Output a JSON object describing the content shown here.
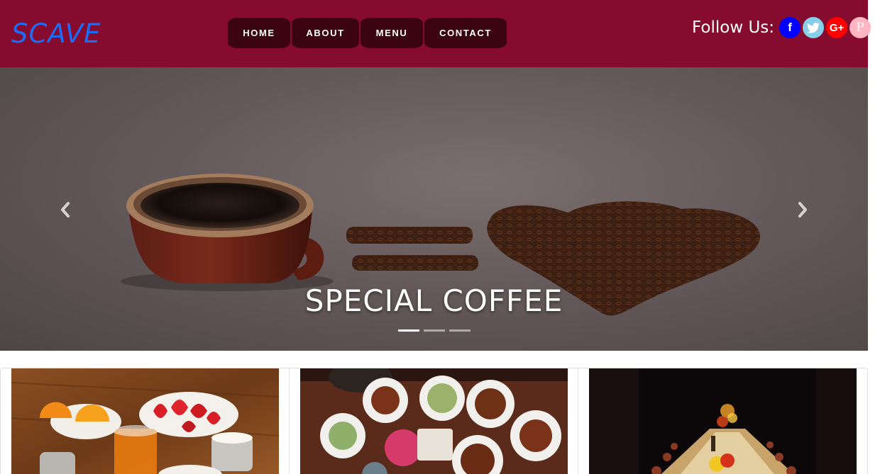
{
  "header": {
    "logo": "SCAVE",
    "nav": [
      {
        "label": "HOME"
      },
      {
        "label": "ABOUT"
      },
      {
        "label": "MENU"
      },
      {
        "label": "CONTACT"
      }
    ],
    "follow_label": "Follow Us:",
    "social": [
      {
        "name": "facebook-icon",
        "glyph": "f",
        "color": "#0000ff"
      },
      {
        "name": "twitter-icon",
        "glyph": "t",
        "color": "#87ceeb"
      },
      {
        "name": "google-plus-icon",
        "glyph": "G+",
        "color": "#ff0000"
      },
      {
        "name": "pinterest-icon",
        "glyph": "P",
        "color": "#ffb6c1"
      }
    ]
  },
  "hero": {
    "caption": "SPECIAL COFFEE",
    "slides_count": 3,
    "active_slide": 1
  },
  "colors": {
    "header_bg": "#850b2f",
    "nav_bg": "#3b0410",
    "logo": "#1e6cf5"
  }
}
